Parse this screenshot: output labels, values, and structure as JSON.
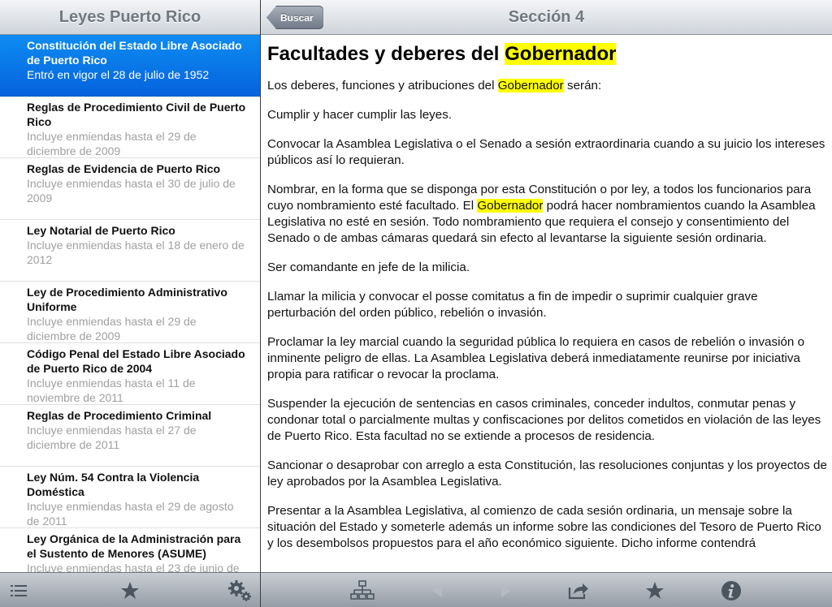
{
  "sidebar": {
    "title": "Leyes Puerto Rico",
    "items": [
      {
        "title": "Constitución del Estado Libre Asociado de Puerto Rico",
        "subtitle": "Entró en vigor el 28 de julio de 1952",
        "selected": true
      },
      {
        "title": "Reglas de Procedimiento Civil de Puerto Rico",
        "subtitle": "Incluye enmiendas hasta el 29 de diciembre de 2009"
      },
      {
        "title": "Reglas de Evidencia de Puerto Rico",
        "subtitle": "Incluye enmiendas hasta el 30 de julio de 2009"
      },
      {
        "title": "Ley Notarial de Puerto Rico",
        "subtitle": "Incluye enmiendas hasta el 18 de enero de 2012"
      },
      {
        "title": "Ley de Procedimiento Administrativo Uniforme",
        "subtitle": "Incluye enmiendas hasta el 29 de diciembre de 2009"
      },
      {
        "title": "Código Penal del Estado Libre Asociado de Puerto Rico de 2004",
        "subtitle": "Incluye enmiendas hasta el 11 de noviembre de 2011"
      },
      {
        "title": "Reglas de Procedimiento Criminal",
        "subtitle": "Incluye enmiendas hasta el 27 de diciembre de 2011"
      },
      {
        "title": "Ley Núm. 54 Contra la Violencia Doméstica",
        "subtitle": "Incluye enmiendas hasta el 29 de agosto de 2011"
      },
      {
        "title": "Ley Orgánica de la Administración para el Sustento de Menores (ASUME)",
        "subtitle": "Incluye enmiendas hasta el 23 de junio de"
      }
    ],
    "toolbar": {
      "list_icon": "list-icon",
      "favorites_icon": "star-icon",
      "settings_icon": "gear-icon"
    }
  },
  "detail": {
    "back_label": "Buscar",
    "title": "Sección 4",
    "heading_prefix": "Facultades y deberes del ",
    "heading_highlight": "Gobernador",
    "highlight_color": "#ffff00",
    "paragraphs": [
      [
        {
          "t": "Los deberes, funciones y atribuciones del "
        },
        {
          "t": "Gobernador",
          "hl": true
        },
        {
          "t": " serán:"
        }
      ],
      [
        {
          "t": "Cumplir y hacer cumplir las leyes."
        }
      ],
      [
        {
          "t": "Convocar la Asamblea Legislativa o el Senado a sesión extraordinaria cuando a su juicio los intereses públicos así lo requieran."
        }
      ],
      [
        {
          "t": "Nombrar, en la forma que se disponga por esta Constitución o por ley, a todos los funcionarios para cuyo nombramiento esté facultado. El "
        },
        {
          "t": "Gobernador",
          "hl": true
        },
        {
          "t": " podrá hacer nombramientos cuando la Asamblea Legislativa no esté en sesión. Todo nombramiento que requiera el consejo y consentimiento del Senado o de ambas cámaras quedará sin efecto al levantarse la siguiente sesión ordinaria."
        }
      ],
      [
        {
          "t": "Ser comandante en jefe de la milicia."
        }
      ],
      [
        {
          "t": "Llamar la milicia y convocar el posse comitatus a fin de impedir o suprimir cualquier grave perturbación del orden público, rebelión o invasión."
        }
      ],
      [
        {
          "t": "Proclamar la ley marcial cuando la seguridad pública lo requiera en casos de rebelión o invasión o inminente peligro de ellas. La Asamblea Legislativa deberá inmediatamente reunirse por iniciativa propia para ratificar o revocar la proclama."
        }
      ],
      [
        {
          "t": "Suspender la ejecución de sentencias en casos criminales, conceder indultos, conmutar penas y condonar total o parcialmente multas y confiscaciones por delitos cometidos en violación de las leyes de Puerto Rico. Esta facultad no se extiende a procesos de residencia."
        }
      ],
      [
        {
          "t": "Sancionar o desaprobar con arreglo a esta Constitución, las resoluciones conjuntas y los proyectos de ley aprobados por la Asamblea Legislativa."
        }
      ],
      [
        {
          "t": "Presentar a la Asamblea Legislativa, al comienzo de cada sesión ordinaria, un mensaje sobre la situación del Estado y someterle además un informe sobre las condiciones del Tesoro de Puerto Rico y los desembolsos propuestos para el año económico siguiente. Dicho informe contendrá"
        }
      ]
    ],
    "toolbar": {
      "tree_icon": "hierarchy-icon",
      "prev_icon": "arrow-left-icon",
      "next_icon": "arrow-right-icon",
      "share_icon": "share-icon",
      "bookmark_icon": "star-icon",
      "info_icon": "info-icon"
    }
  },
  "colors": {
    "selected_row": "#0a73e8",
    "bar_title_text": "#71787f",
    "subtitle_text": "#a0a0a0"
  }
}
